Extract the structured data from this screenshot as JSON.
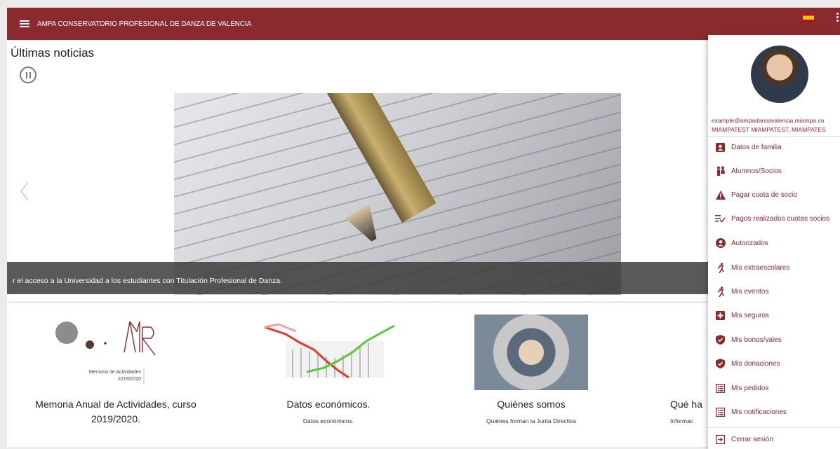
{
  "header": {
    "app_title": "AMPA CONSERVATORIO PROFESIONAL DE DANZA DE VALENCIA",
    "color": "#8b2a2e"
  },
  "news": {
    "title": "Últimas noticias",
    "caption": "r el acceso a la Universidad a los estudiantes con Titulación Profesional de Danza."
  },
  "cards": [
    {
      "title": "Memoria Anual de Actividades, curso 2019/2020.",
      "subtitle": "",
      "thumb_caption": "Memoria de Actividades\n2019/2020"
    },
    {
      "title": "Datos económicos.",
      "subtitle": "Datos económicos."
    },
    {
      "title": "Quiénes somos",
      "subtitle": "Quiénes forman la Junta Directiva"
    },
    {
      "title": "Qué ha",
      "subtitle": "Informac"
    }
  ],
  "drawer": {
    "email": "example@ampadansavalencia.miampa.co",
    "user": "MIAMPATEST MIAMPATEST, MIAMPATES",
    "items": [
      {
        "label": "Datos de familia",
        "icon": "contact-card-icon"
      },
      {
        "label": "Alumnos/Socios",
        "icon": "people-icon"
      },
      {
        "label": "Pagar cuota de socio",
        "icon": "warning-icon"
      },
      {
        "label": "Pagos realizados cuotas socios",
        "icon": "list-check-icon"
      },
      {
        "label": "Autorizados",
        "icon": "account-circle-icon"
      },
      {
        "label": "Mis extraescolares",
        "icon": "running-icon"
      },
      {
        "label": "Mis eventos",
        "icon": "running-icon"
      },
      {
        "label": "Mis seguros",
        "icon": "medical-plus-icon"
      },
      {
        "label": "Mis bonos/vales",
        "icon": "shield-check-icon"
      },
      {
        "label": "Mis donaciones",
        "icon": "shield-check-icon"
      },
      {
        "label": "Mis pedidos",
        "icon": "list-box-icon"
      },
      {
        "label": "Mis notificaciones",
        "icon": "list-box-icon"
      }
    ],
    "logout": "Cerrar sesión"
  }
}
